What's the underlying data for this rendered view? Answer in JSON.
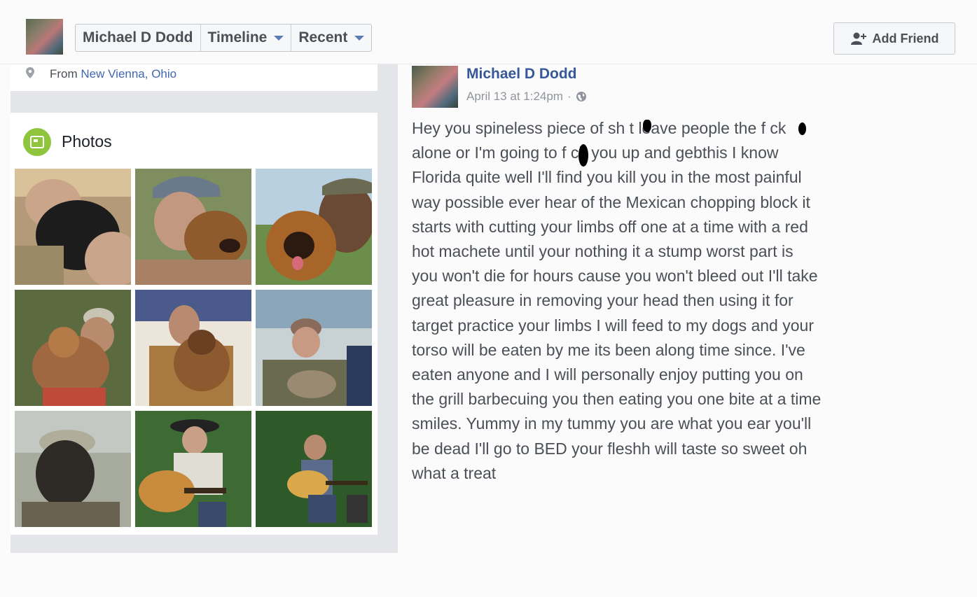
{
  "header": {
    "profile_name": "Michael D Dodd",
    "nav": [
      {
        "label": "Michael D Dodd",
        "has_dropdown": false
      },
      {
        "label": "Timeline",
        "has_dropdown": true
      },
      {
        "label": "Recent",
        "has_dropdown": true
      }
    ],
    "add_friend_label": "Add Friend",
    "add_friend_icon": "add-friend-icon"
  },
  "intro": {
    "from_prefix": "From",
    "location": "New Vienna, Ohio",
    "icon": "location-pin-icon"
  },
  "photos": {
    "title": "Photos",
    "icon": "photos-icon",
    "count": 9
  },
  "post": {
    "author": "Michael D Dodd",
    "timestamp": "April 13 at 1:24pm",
    "separator": "·",
    "privacy_icon": "globe-icon",
    "lines": [
      "Hey you spineless piece of sh t leave people the f ck",
      "alone or I'm going to f ck you up and gebthis I know",
      "Florida quite well I'll find you kill you in the most painful",
      "way possible ever hear of the Mexican chopping block it",
      "starts with cutting your limbs off one at a time with a red",
      "hot machete until your nothing it a stump worst part is",
      "you won't die for hours cause you won't bleed out I'll take",
      "great pleasure in removing your head then using it for",
      "target practice your limbs I will feed to my dogs and your",
      "torso will be eaten by me its been along time since. I've",
      "eaten anyone and I will personally enjoy putting you on",
      "the grill barbecuing you then eating you one bite at a time",
      "smiles. Yummy in my tummy you are what you ear you'll",
      "be dead I'll go to BED your fleshh will taste so sweet oh",
      "what a treat"
    ]
  },
  "colors": {
    "link_blue": "#365899",
    "location_blue": "#4267b2",
    "photos_green": "#8fc43d",
    "text_gray": "#4b4f56",
    "meta_gray": "#90949c"
  }
}
